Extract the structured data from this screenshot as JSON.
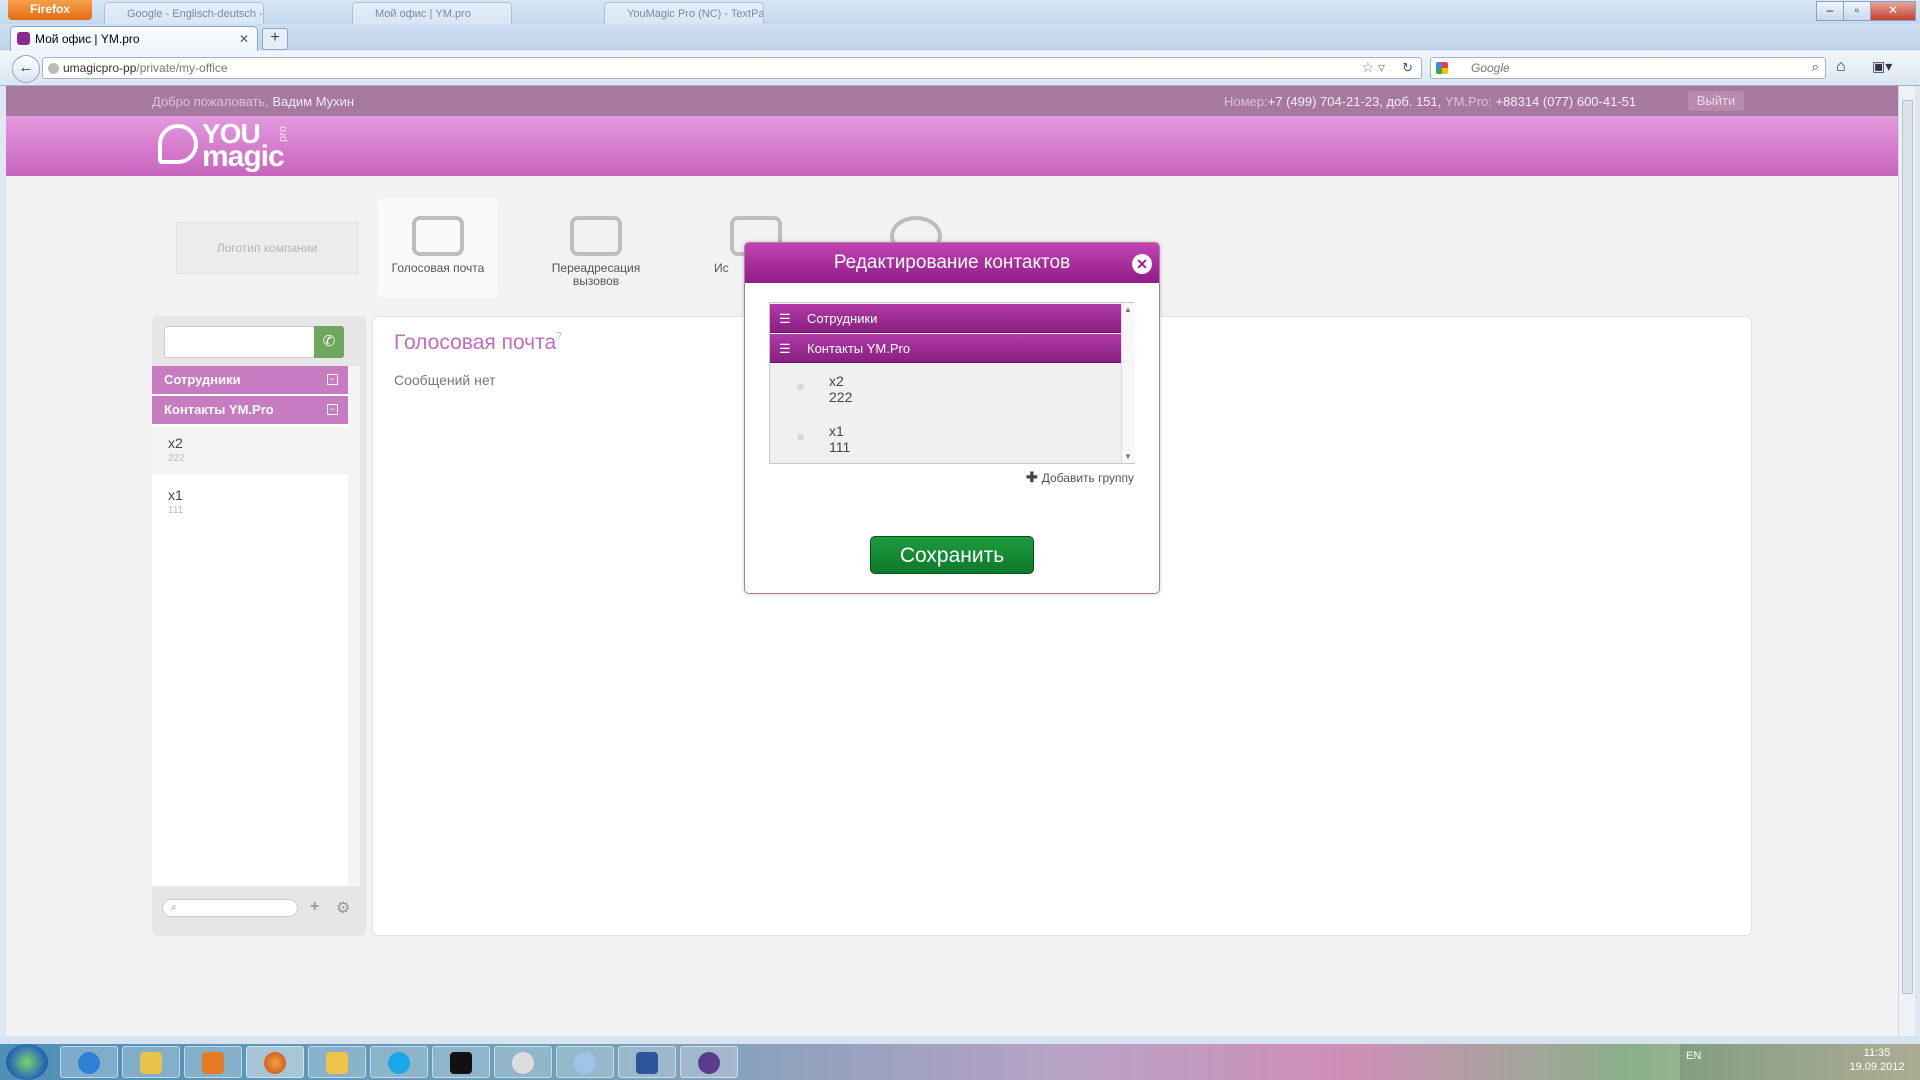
{
  "browser": {
    "menu_button": "Firefox",
    "ghost_tabs": [
      "Google - Englisch-deutsch - Leo.Ve",
      "Мой офис | YM.pro",
      "YouMagic Pro (NC) - TextPad"
    ],
    "tab_title": "Мой офис | YM.pro",
    "url_host": "umagicpro-pp",
    "url_path": "/private/my-office",
    "search_placeholder": "Google"
  },
  "header": {
    "welcome_prefix": "Добро пожаловать,",
    "user_name": "Вадим Мухин",
    "phone_label": "Номер:",
    "phone_number": "+7 (499) 704-21-23, доб. 151,",
    "ympro_label": "YM.Pro:",
    "ympro_number": "+88314 (077) 600-41-51",
    "logout": "Выйти",
    "logo": {
      "you": "YOU",
      "magic": "magic",
      "pro": "pro"
    }
  },
  "features": {
    "company_logo": "Логотип компании",
    "voicemail": "Голосовая почта",
    "forwarding_line1": "Переадресация",
    "forwarding_line2": "вызовов",
    "third_partial": "Ис"
  },
  "sidebar": {
    "groups": [
      {
        "label": "Сотрудники"
      },
      {
        "label": "Контакты YM.Pro"
      }
    ],
    "contacts": [
      {
        "name": "x2",
        "phone": "222"
      },
      {
        "name": "x1",
        "phone": "111"
      }
    ]
  },
  "main": {
    "title": "Голосовая почта",
    "help": "?",
    "message": "Сообщений нет"
  },
  "modal": {
    "title": "Редактирование контактов",
    "groups": [
      {
        "label": "Сотрудники"
      },
      {
        "label": "Контакты YM.Pro"
      }
    ],
    "contacts": [
      {
        "name": "x2",
        "phone": "222"
      },
      {
        "name": "x1",
        "phone": "111"
      }
    ],
    "add_group": "Добавить группу",
    "save": "Сохранить"
  },
  "taskbar": {
    "lang": "EN",
    "time": "11:35",
    "date": "19.09.2012"
  },
  "colors": {
    "brand_pink": "#c864be",
    "modal_purple": "#9c2093",
    "save_green": "#0b7a2a"
  }
}
